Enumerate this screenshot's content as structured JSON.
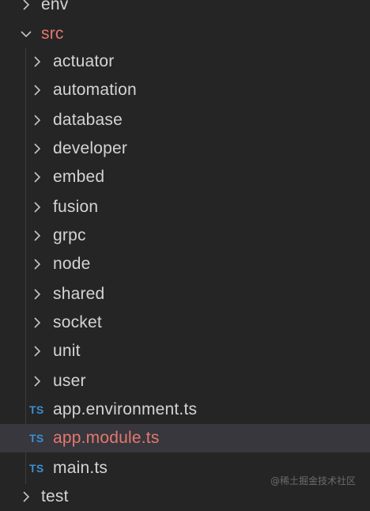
{
  "explorer": {
    "top_folder": {
      "label": "env",
      "expanded": false
    },
    "src_folder": {
      "label": "src",
      "expanded": true,
      "status": "modified"
    },
    "src_children": [
      {
        "label": "actuator",
        "kind": "folder"
      },
      {
        "label": "automation",
        "kind": "folder"
      },
      {
        "label": "database",
        "kind": "folder"
      },
      {
        "label": "developer",
        "kind": "folder"
      },
      {
        "label": "embed",
        "kind": "folder"
      },
      {
        "label": "fusion",
        "kind": "folder"
      },
      {
        "label": "grpc",
        "kind": "folder"
      },
      {
        "label": "node",
        "kind": "folder"
      },
      {
        "label": "shared",
        "kind": "folder"
      },
      {
        "label": "socket",
        "kind": "folder"
      },
      {
        "label": "unit",
        "kind": "folder"
      },
      {
        "label": "user",
        "kind": "folder"
      }
    ],
    "files": [
      {
        "label": "app.environment.ts",
        "icon_text": "TS",
        "selected": false,
        "status": "normal"
      },
      {
        "label": "app.module.ts",
        "icon_text": "TS",
        "selected": true,
        "status": "modified"
      },
      {
        "label": "main.ts",
        "icon_text": "TS",
        "selected": false,
        "status": "normal"
      }
    ],
    "bottom_folder": {
      "label": "test",
      "expanded": false
    }
  },
  "watermark": "@稀土掘金技术社区",
  "colors": {
    "background": "#252526",
    "selected_row": "#37373d",
    "text": "#d4d4d4",
    "git_modified": "#e5786d",
    "ts_icon": "#3b8fcf",
    "chevron": "#c5c5c5"
  }
}
